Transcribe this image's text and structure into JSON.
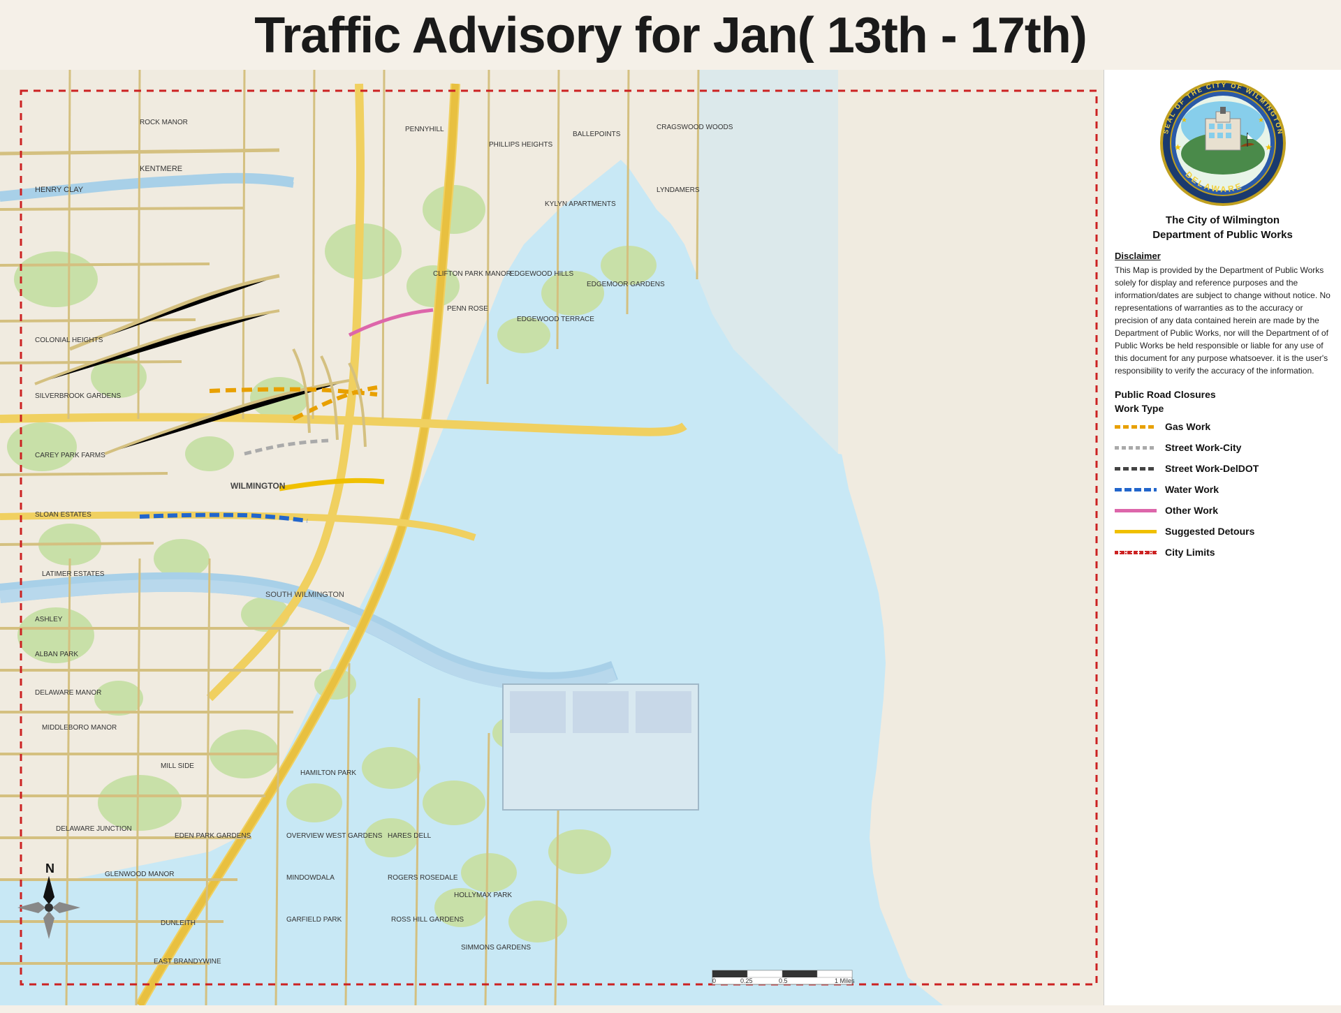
{
  "page": {
    "title": "Traffic Advisory for Jan( 13th - 17th)"
  },
  "sidebar": {
    "org_name": "The City of Wilmington\nDepartment of Public Works",
    "disclaimer_title": "Disclaimer",
    "disclaimer_text": "This Map is provided by the Department of Public Works solely for display and reference purposes and the information/dates are subject to change without notice. No representations of warranties as to the accuracy or precision of any data contained herein are made by the Department of Public Works, nor will the Department of of Public Works be held responsible or liable for any use of this document for any purpose whatsoever. it is the user's responsibility to verify the accuracy of the information.",
    "legend_title": "Public Road Closures\nWork Type",
    "legend_items": [
      {
        "id": "gas-work",
        "label": "Gas Work",
        "style": "gas"
      },
      {
        "id": "street-work-city",
        "label": "Street Work-City",
        "style": "street-city"
      },
      {
        "id": "street-work-deldot",
        "label": "Street Work-DelDOT",
        "style": "street-deldot"
      },
      {
        "id": "water-work",
        "label": "Water Work",
        "style": "water"
      },
      {
        "id": "other-work",
        "label": "Other Work",
        "style": "other"
      },
      {
        "id": "suggested-detours",
        "label": "Suggested Detours",
        "style": "detour"
      },
      {
        "id": "city-limits",
        "label": "City Limits",
        "style": "city-limits"
      }
    ]
  },
  "map": {
    "north_label": "N",
    "scale_label": "0    0.25    0.5              1 Miles"
  }
}
